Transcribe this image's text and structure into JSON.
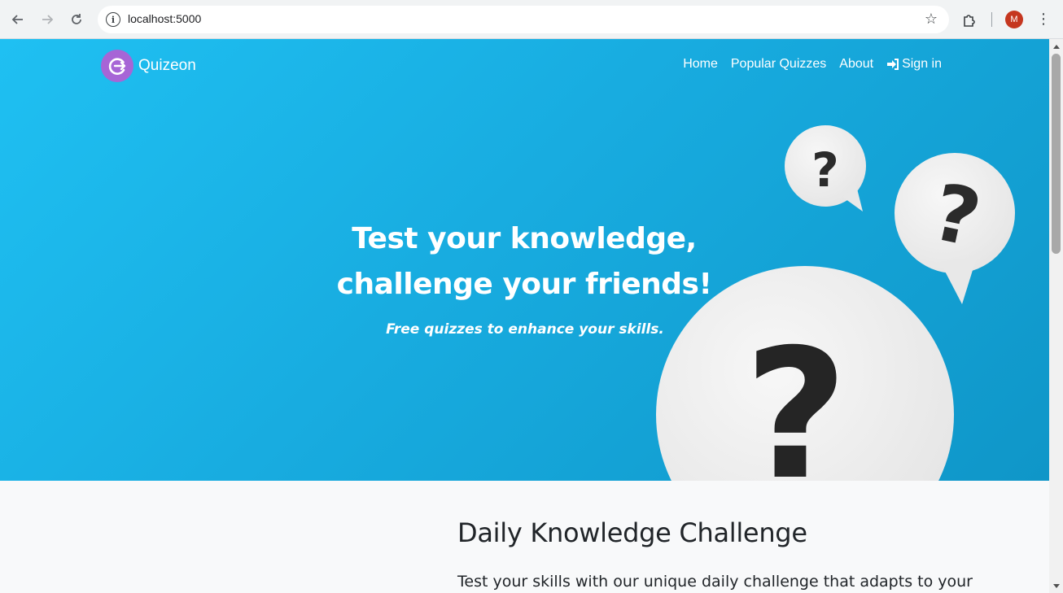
{
  "browser": {
    "url": "localhost:5000",
    "profile_initial": "M",
    "back_icon": "arrow-left-icon",
    "forward_icon": "arrow-right-icon",
    "reload_icon": "reload-icon"
  },
  "site": {
    "brand": "Quizeon",
    "nav": {
      "home": "Home",
      "popular": "Popular Quizzes",
      "about": "About",
      "signin": "Sign in"
    }
  },
  "hero": {
    "title": "Test your knowledge, challenge your friends!",
    "subtitle": "Free quizzes to enhance your skills."
  },
  "section": {
    "title": "Daily Knowledge Challenge",
    "text": "Test your skills with our unique daily challenge that adapts to your"
  },
  "colors": {
    "hero_start": "#1fc0f2",
    "hero_end": "#0f96c8",
    "brand_logo": "#a765d6",
    "avatar": "#c5361f"
  }
}
